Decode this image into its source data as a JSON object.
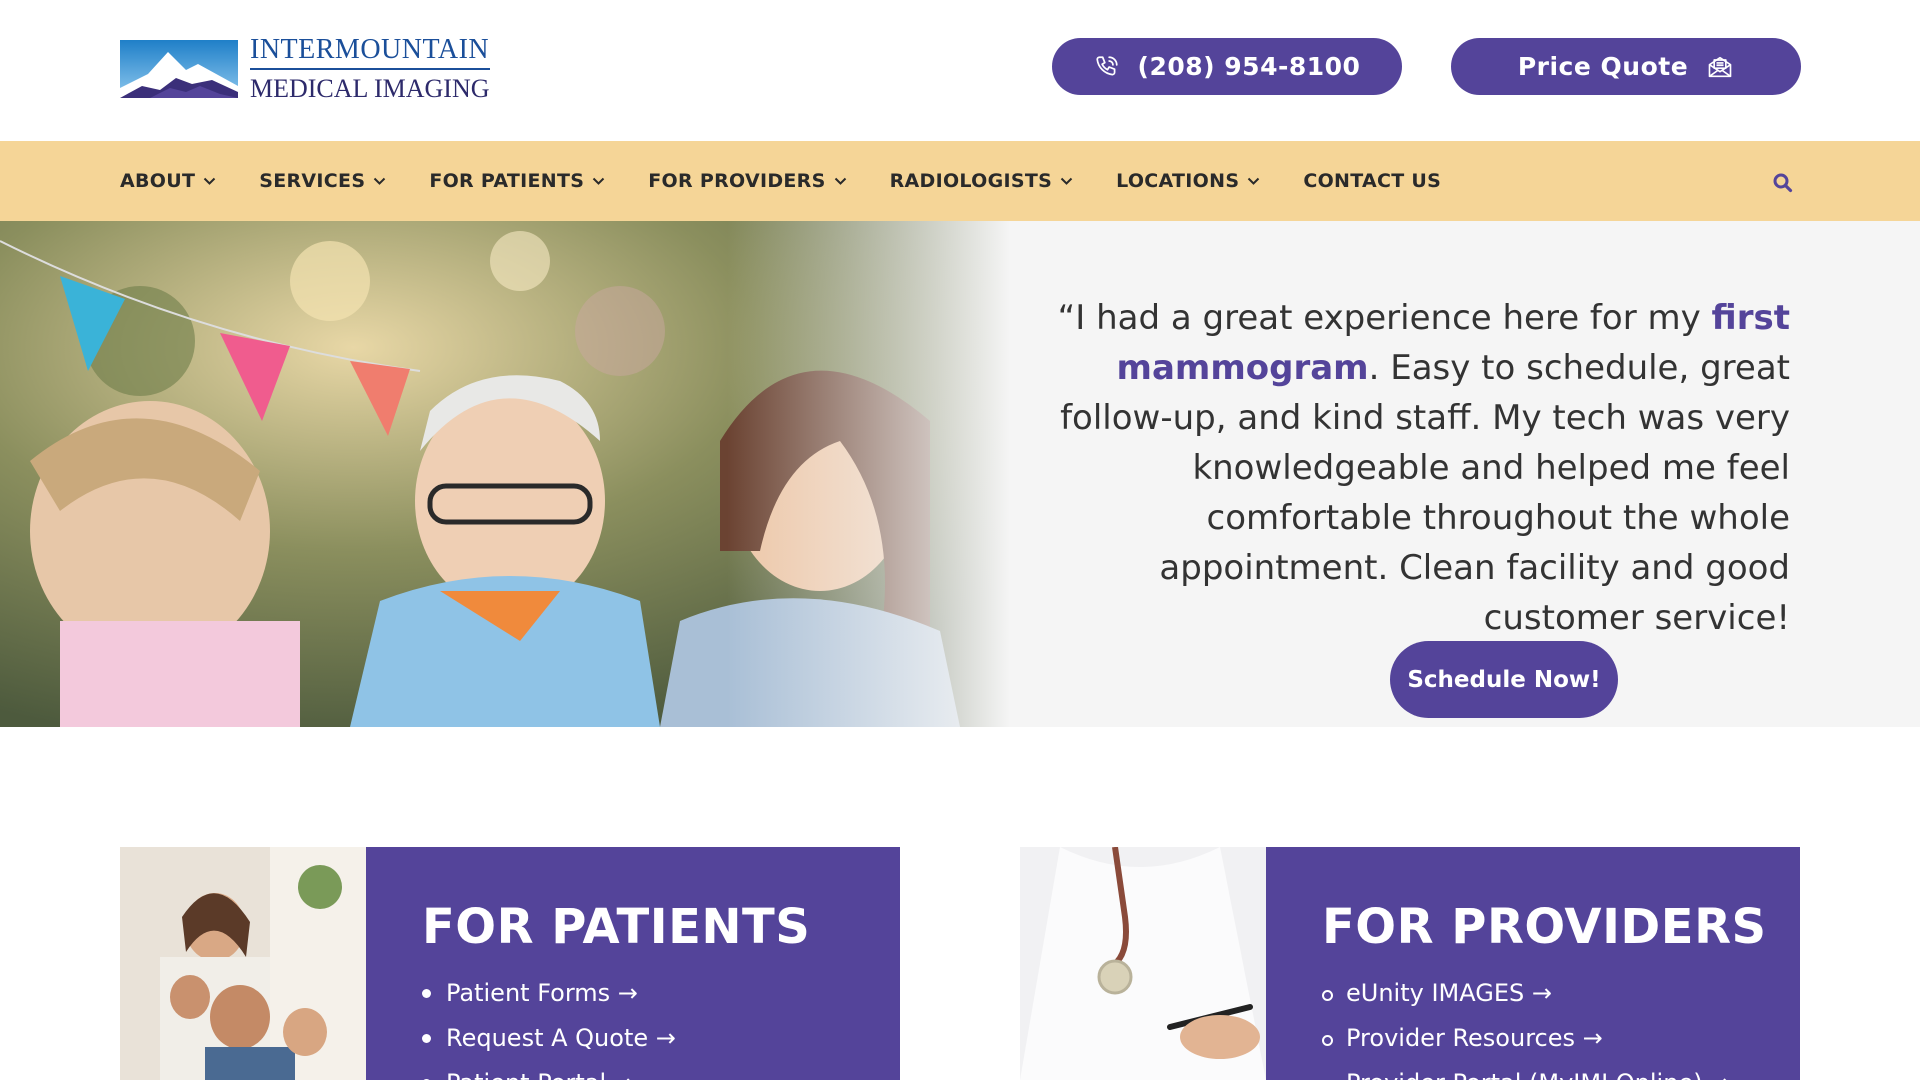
{
  "header": {
    "logo": {
      "line1": "INTERMOUNTAIN",
      "line2": "MEDICAL IMAGING"
    },
    "phone_label": "(208) 954-8100",
    "quote_label": "Price Quote"
  },
  "nav": {
    "items": [
      {
        "label": "ABOUT",
        "dropdown": true
      },
      {
        "label": "SERVICES",
        "dropdown": true
      },
      {
        "label": "FOR PATIENTS",
        "dropdown": true
      },
      {
        "label": "FOR PROVIDERS",
        "dropdown": true
      },
      {
        "label": "RADIOLOGISTS",
        "dropdown": true
      },
      {
        "label": "LOCATIONS",
        "dropdown": true
      },
      {
        "label": "CONTACT US",
        "dropdown": false
      }
    ]
  },
  "hero": {
    "quote_open": "“I had a great experience here for my ",
    "quote_highlight": "first mammogram",
    "quote_rest": ". Easy to schedule, great follow-up, and kind staff. My tech was very knowledgeable and helped me feel comfortable throughout the whole appointment. Clean facility and good customer service!",
    "cta": "Schedule Now!"
  },
  "cards": {
    "patients": {
      "title": "FOR PATIENTS",
      "links": [
        "Patient Forms →",
        "Request A Quote →",
        "Patient Portal →"
      ]
    },
    "providers": {
      "title": "FOR PROVIDERS",
      "links": [
        "eUnity IMAGES →",
        "Provider Resources →",
        "Provider Portal (MyIMI Online) →"
      ]
    }
  },
  "colors": {
    "brand_purple": "#54449a",
    "nav_background": "#f5d597",
    "hero_background": "#f5f5f5"
  },
  "icons": {
    "phone": "phone-icon",
    "quote": "envelope-open-icon",
    "search": "search-icon",
    "dropdown": "chevron-down-icon"
  }
}
